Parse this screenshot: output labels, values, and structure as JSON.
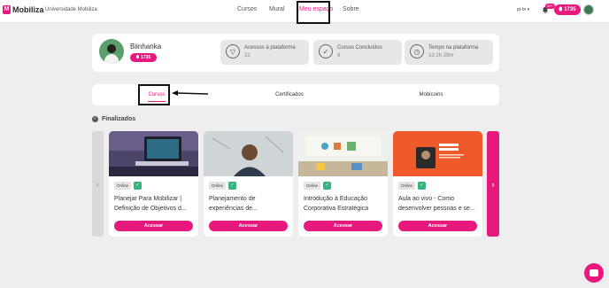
{
  "header": {
    "logo_mark": "M",
    "logo_text": "Mobiliza",
    "org_name": "Universidade Mobiliza",
    "nav": [
      "Cursos",
      "Mural",
      "Meu espaço",
      "Sobre"
    ],
    "active_nav_index": 2,
    "language": "pt-br",
    "notification_count": "99+",
    "coins": "1735"
  },
  "profile": {
    "name": "Biinhanka",
    "coins": "1735",
    "stats": [
      {
        "label": "Acessos à plataforma",
        "value": "22",
        "icon": "compass-icon"
      },
      {
        "label": "Cursos Concluídos",
        "value": "6",
        "icon": "check-circle-icon"
      },
      {
        "label": "Tempo na plataforma",
        "value": "1d 2h 39m",
        "icon": "clock-icon"
      }
    ]
  },
  "tabs": {
    "items": [
      "Cursos",
      "Certificados",
      "Mobicoins"
    ],
    "active": "Cursos"
  },
  "section": {
    "title": "Finalizados"
  },
  "courses": [
    {
      "mode": "Online",
      "title": "Planejar Para Mobilizar | Definição de Objetivos d...",
      "button": "Acessar",
      "image": "laptop-desk-photo"
    },
    {
      "mode": "Online",
      "title": "Planejamento de experiências de...",
      "button": "Acessar",
      "image": "person-whiteboard-photo"
    },
    {
      "mode": "Online",
      "title": "Introdução à Educação Corporativa Estratégica",
      "button": "Acessar",
      "image": "classroom-photo"
    },
    {
      "mode": "Online",
      "title": "Aula ao vivo - Como desenvolver pessoas e se...",
      "button": "Acessar",
      "image": "speaker-banner"
    }
  ],
  "colors": {
    "brand": "#e8197d",
    "success": "#36b37e",
    "background": "#eeeeee"
  }
}
